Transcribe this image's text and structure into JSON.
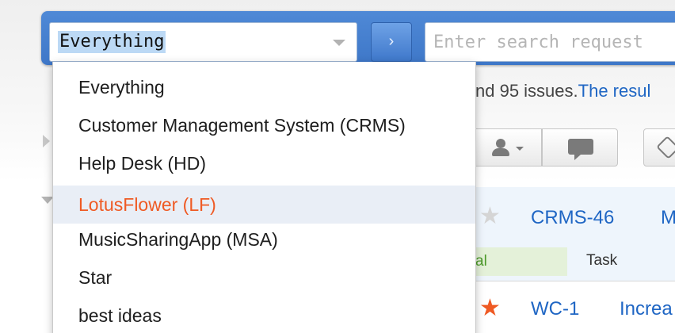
{
  "search": {
    "scope_value": "Everything",
    "query_placeholder": "Enter search request",
    "go_icon": "chevron-right-icon"
  },
  "dropdown": {
    "items": [
      {
        "label": "Everything"
      },
      {
        "label": "Customer Management System (CRMS)"
      },
      {
        "label": "Help Desk (HD)"
      },
      {
        "label": "LotusFlower (LF)"
      },
      {
        "label": "MusicSharingApp (MSA)"
      },
      {
        "label": "Star"
      },
      {
        "label": "best ideas"
      }
    ],
    "highlighted_index": 3
  },
  "results": {
    "summary_text": "nd 95 issues.",
    "summary_link": "The resul"
  },
  "issues": [
    {
      "key": "CRMS-46",
      "summary": "M",
      "starred": false,
      "status": "al",
      "type": "Task"
    },
    {
      "key": "WC-1",
      "summary": "Increa",
      "starred": true
    }
  ],
  "colors": {
    "brand_blue": "#3e77c8",
    "link": "#1f66c4",
    "accent_orange": "#ef5a24",
    "status_green": "#4c9a2a"
  }
}
